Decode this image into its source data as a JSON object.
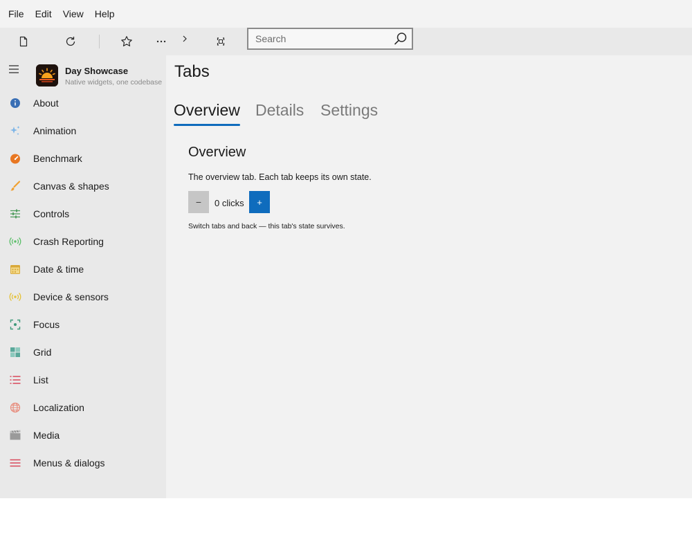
{
  "menubar": {
    "items": [
      "File",
      "Edit",
      "View",
      "Help"
    ]
  },
  "toolbar": {
    "buttons": [
      "new-file-icon",
      "refresh-icon",
      "star-icon",
      "more-icon",
      "chevron-right-icon",
      "fit-screen-icon"
    ],
    "search": {
      "placeholder": "Search",
      "value": ""
    }
  },
  "sidebar": {
    "app_name": "Day Showcase",
    "app_tagline": "Native widgets, one codebase",
    "items": [
      {
        "label": "About",
        "icon": "info-icon",
        "color": "#3a6fb5"
      },
      {
        "label": "Animation",
        "icon": "sparkle-icon",
        "color": "#7fb6e8"
      },
      {
        "label": "Benchmark",
        "icon": "gauge-icon",
        "color": "#e87722"
      },
      {
        "label": "Canvas & shapes",
        "icon": "brush-icon",
        "color": "#f0a030"
      },
      {
        "label": "Controls",
        "icon": "sliders-icon",
        "color": "#4a9a5a"
      },
      {
        "label": "Crash Reporting",
        "icon": "broadcast-icon",
        "color": "#5cbf6a"
      },
      {
        "label": "Date & time",
        "icon": "calendar-icon",
        "color": "#d9a93a"
      },
      {
        "label": "Device & sensors",
        "icon": "sensor-icon",
        "color": "#e5c23a"
      },
      {
        "label": "Focus",
        "icon": "focus-icon",
        "color": "#3f9a7a"
      },
      {
        "label": "Grid",
        "icon": "grid-icon",
        "color": "#5aa89a"
      },
      {
        "label": "List",
        "icon": "list-icon",
        "color": "#d9485a"
      },
      {
        "label": "Localization",
        "icon": "globe-icon",
        "color": "#e88a7a"
      },
      {
        "label": "Media",
        "icon": "film-icon",
        "color": "#9a9a9a"
      },
      {
        "label": "Menus & dialogs",
        "icon": "menu-icon",
        "color": "#d9485a"
      }
    ]
  },
  "main": {
    "title": "Tabs",
    "tabs": [
      {
        "label": "Overview",
        "active": true
      },
      {
        "label": "Details",
        "active": false
      },
      {
        "label": "Settings",
        "active": false
      }
    ],
    "panel": {
      "title": "Overview",
      "description": "The overview tab. Each tab keeps its own state.",
      "minus_label": "−",
      "plus_label": "+",
      "clicks_text": "0 clicks",
      "hint": "Switch tabs and back — this tab's state survives."
    }
  },
  "colors": {
    "accent": "#0f6cbd",
    "sidebar_bg": "#e9e9e9",
    "content_bg": "#f2f2f2"
  }
}
